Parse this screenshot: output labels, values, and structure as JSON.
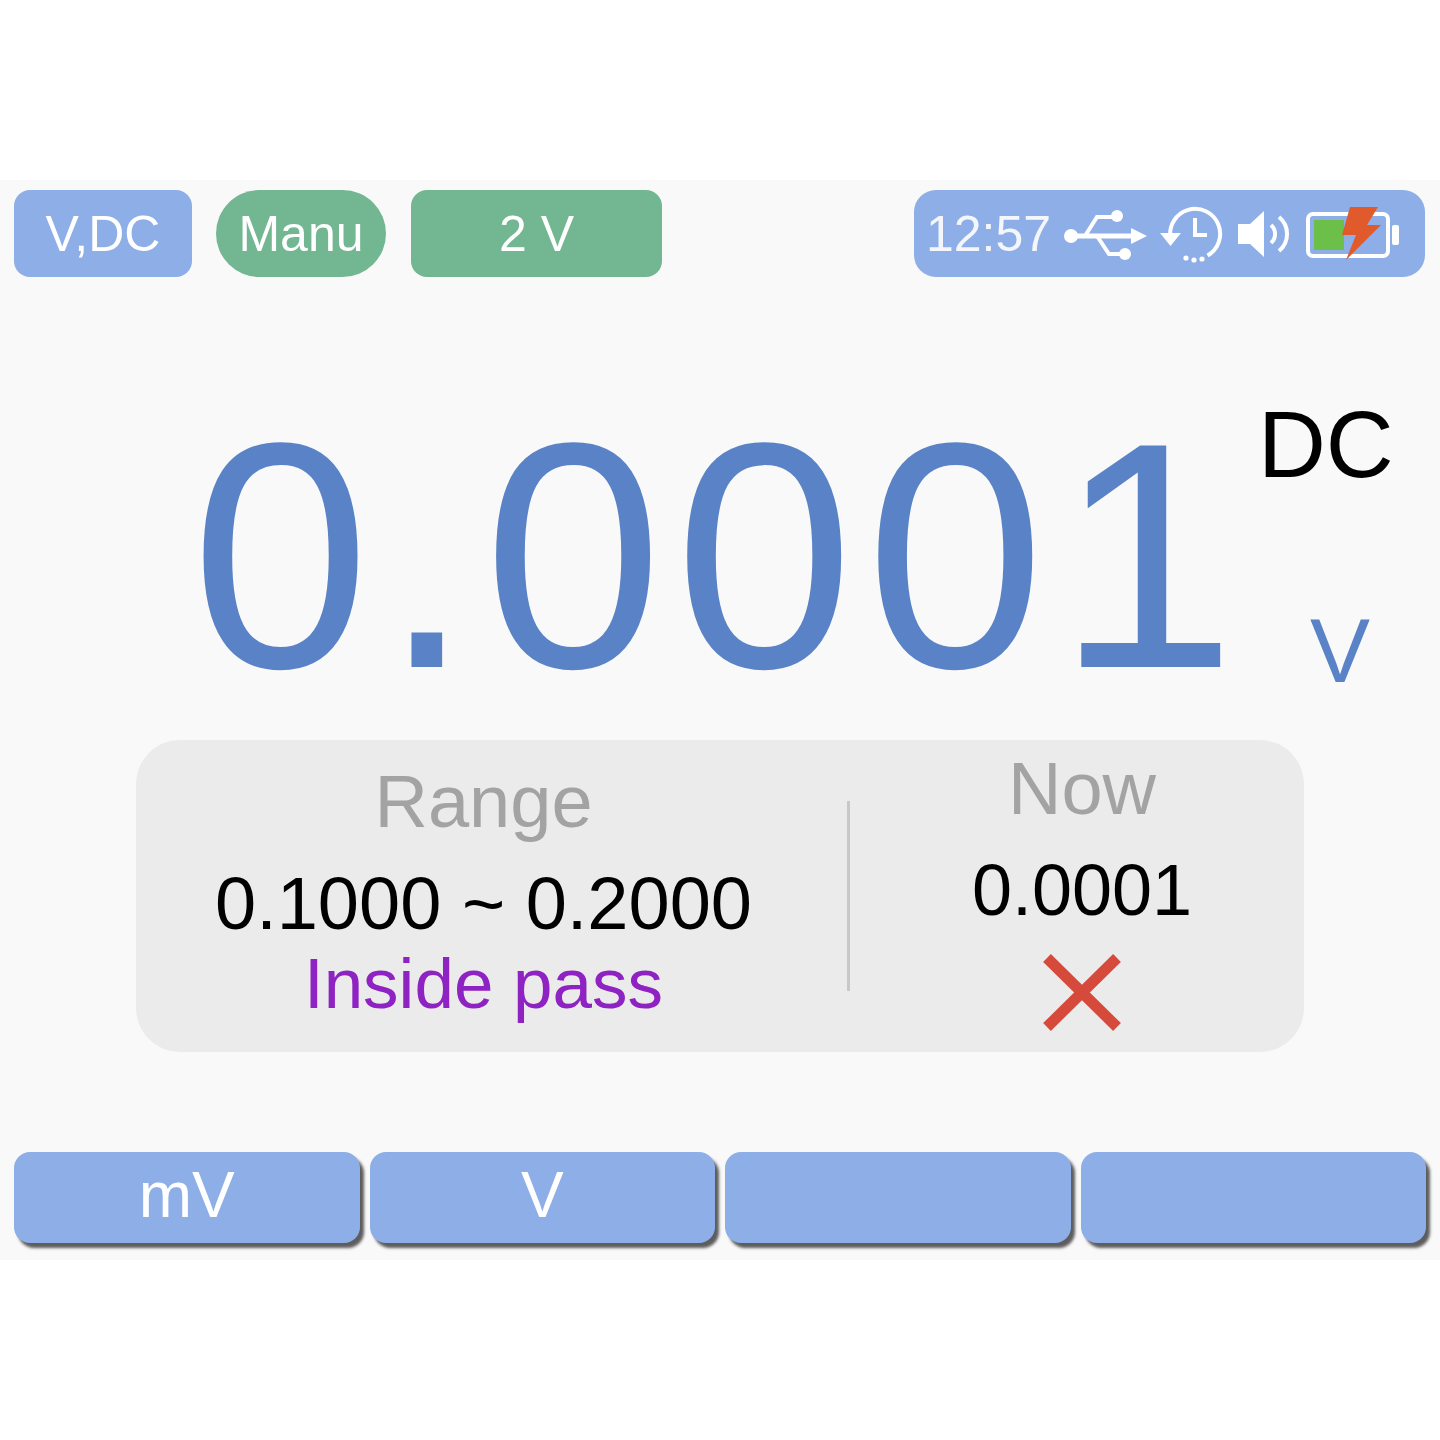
{
  "mode_tags": [
    {
      "label": "V,DC",
      "color": "#8daee6",
      "kind": "tag"
    },
    {
      "label": "Manu",
      "color": "#72b792",
      "kind": "pill"
    },
    {
      "label": "2 V",
      "color": "#72b792",
      "kind": "tag"
    }
  ],
  "status_bar": {
    "time": "12:57"
  },
  "reading": {
    "value": "0.0001",
    "coupling": "DC",
    "unit": "V"
  },
  "limit_panel": {
    "range_heading": "Range",
    "range": "0.1000 ~ 0.2000",
    "mode": "Inside pass",
    "now_heading": "Now",
    "now_value": "0.0001",
    "pass": false
  },
  "softkeys": [
    {
      "kind": "labeled",
      "label": "mV"
    },
    {
      "kind": "labeled",
      "label": "V"
    },
    {
      "kind": "blank"
    },
    {
      "kind": "blank"
    }
  ]
}
